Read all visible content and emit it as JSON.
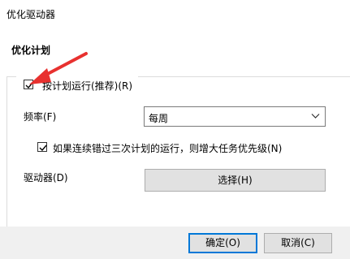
{
  "window": {
    "title": "优化驱动器"
  },
  "schedule": {
    "section_title": "优化计划",
    "run_on_schedule_label": "按计划运行(推荐)(R)",
    "run_on_schedule_checked": true,
    "frequency_label": "频率(F)",
    "frequency_value": "每周",
    "increase_priority_label": "如果连续错过三次计划的运行，则增大任务优先级(N)",
    "increase_priority_checked": true,
    "drives_label": "驱动器(D)",
    "choose_button": "选择(H)"
  },
  "footer": {
    "ok_button": "确定(O)",
    "cancel_button": "取消(C)"
  },
  "colors": {
    "accent": "#0078d7",
    "annotation_arrow": "#e8312f"
  }
}
